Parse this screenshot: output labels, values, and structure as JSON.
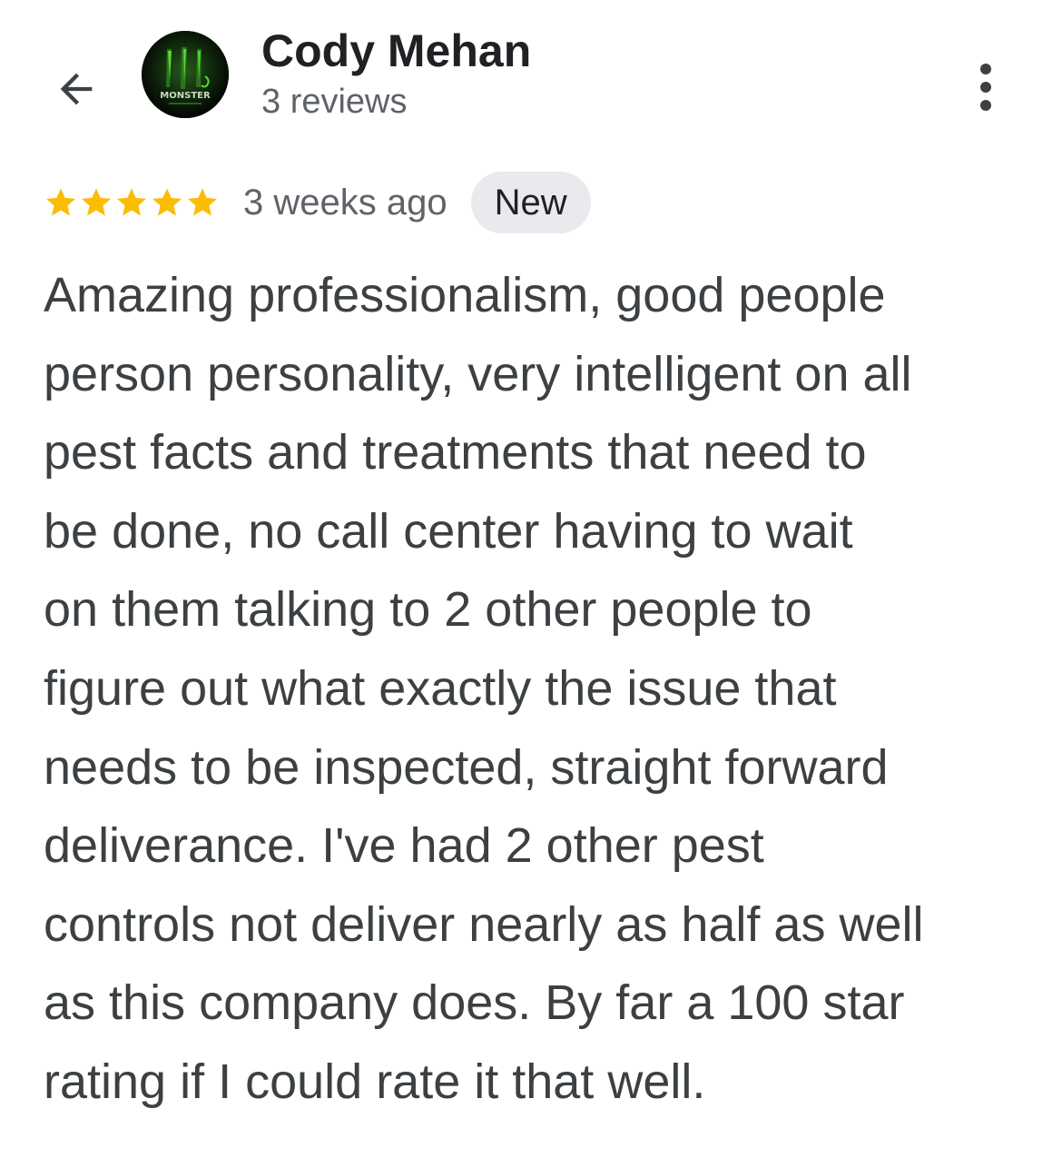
{
  "header": {
    "back_icon": "arrow-back-icon",
    "avatar_icon": "monster-energy-logo",
    "avatar_text": "MONSTER",
    "author_name": "Cody Mehan",
    "review_count": "3 reviews",
    "more_icon": "more-vert-icon"
  },
  "review": {
    "rating": 5,
    "rating_max": 5,
    "star_color": "#fbbc04",
    "time_ago": "3 weeks ago",
    "badge": "New",
    "text": "Amazing professionalism, good people\nperson personality, very intelligent on all\npest facts and treatments that need to\nbe done, no call center having to wait\non them talking to 2 other people to\nfigure out what exactly the issue that\nneeds to be inspected, straight forward\ndeliverance. I've had 2 other pest\ncontrols not deliver nearly as half as well\nas this company does. By far a 100 star\nrating if I could rate it that well."
  },
  "colors": {
    "accent_green": "#3ddc1e",
    "text_primary": "#202124",
    "text_secondary": "#5f6368",
    "badge_background": "#e8eaed"
  }
}
